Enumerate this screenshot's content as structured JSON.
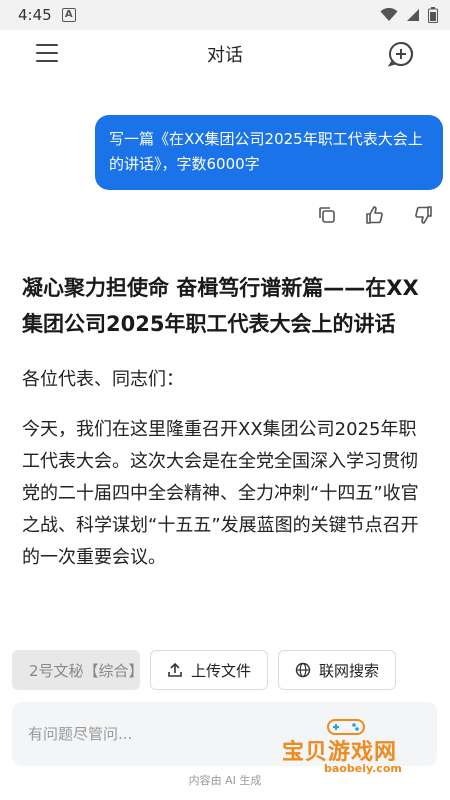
{
  "status_bar": {
    "time": "4:45",
    "notification_letter": "A"
  },
  "header": {
    "title": "对话"
  },
  "user_message": {
    "text": "写一篇《在XX集团公司2025年职工代表大会上的讲话》，字数6000字"
  },
  "answer": {
    "title": "凝心聚力担使命 奋楫笃行谱新篇——在XX集团公司2025年职工代表大会上的讲话",
    "greeting": "各位代表、同志们：",
    "paragraph": "今天，我们在这里隆重召开XX集团公司2025年职工代表大会。这次大会是在全党全国深入学习贯彻党的二十届四中全会精神、全力冲刺“十四五”收官之战、科学谋划“十五五”发展蓝图的关键节点召开的一次重要会议。"
  },
  "toolbar": {
    "model_label": "2号文秘【综合】",
    "upload_label": "上传文件",
    "web_search_label": "联网搜索"
  },
  "input": {
    "placeholder": "有问题尽管问..."
  },
  "footer": {
    "note": "内容由 AI 生成"
  },
  "watermark": {
    "name": "宝贝游戏网",
    "url": "baobeiy.com"
  },
  "colors": {
    "accent": "#1a73e8",
    "watermark": "#f08a1c"
  },
  "icons": {
    "menu": "menu-icon",
    "new_chat": "new-chat-icon",
    "copy": "copy-icon",
    "like": "thumbs-up-icon",
    "dislike": "thumbs-down-icon",
    "upload": "upload-icon",
    "globe": "globe-icon"
  }
}
